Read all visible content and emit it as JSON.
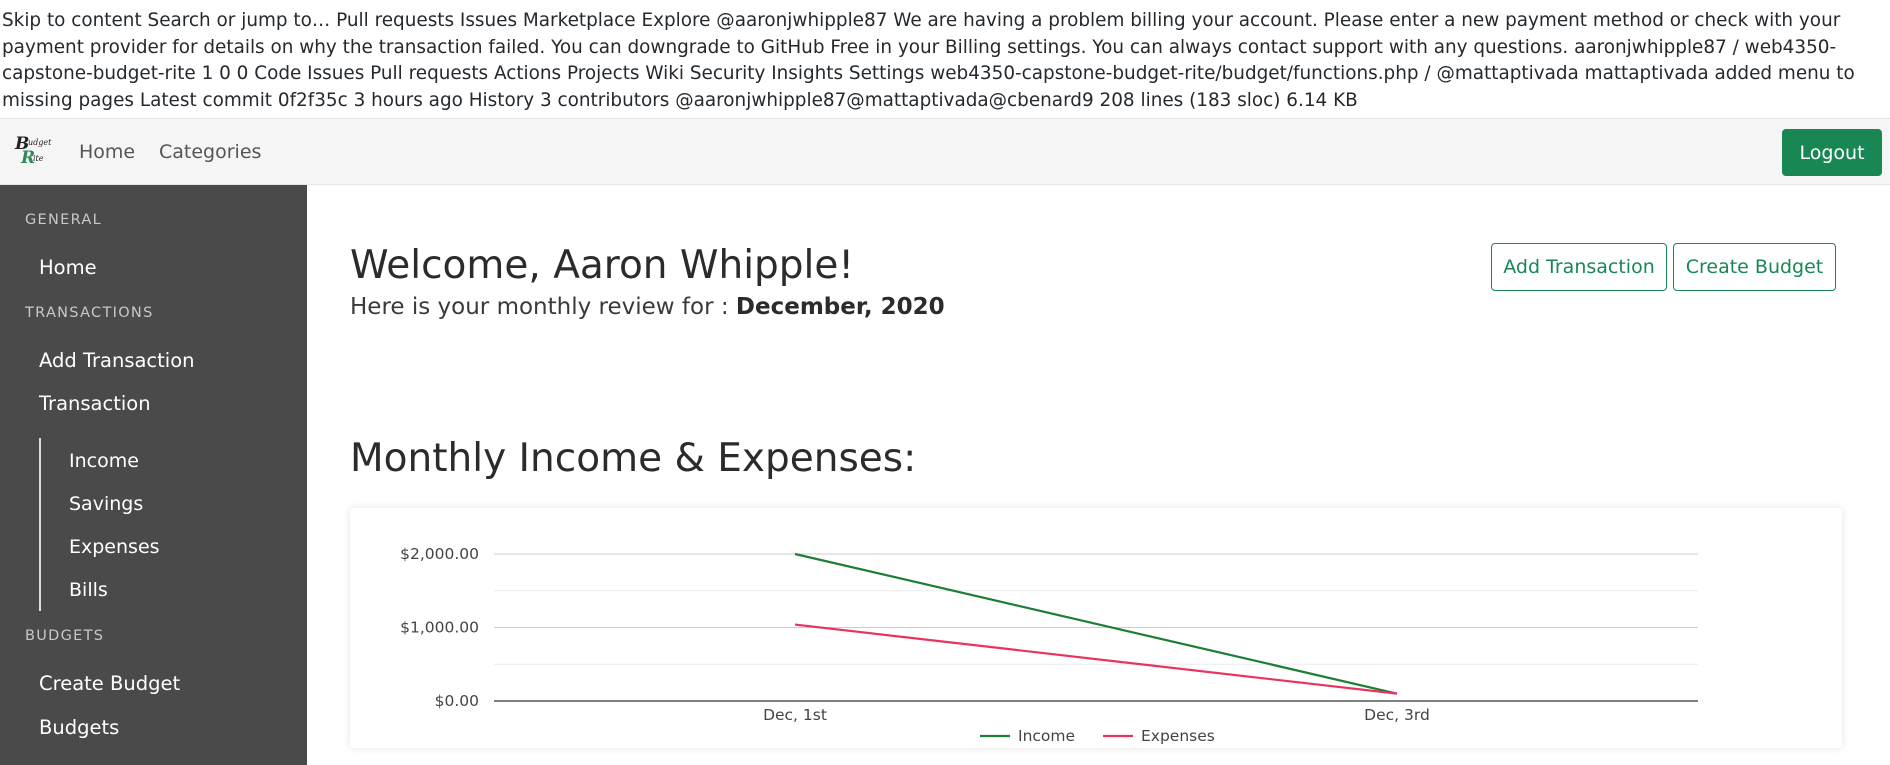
{
  "github_text": "Skip to content Search or jump to… Pull requests Issues Marketplace Explore @aaronjwhipple87 We are having a problem billing your account. Please enter a new payment method or check with your payment provider for details on why the transaction failed. You can downgrade to GitHub Free in your Billing settings. You can always contact support with any questions. aaronjwhipple87 / web4350-capstone-budget-rite 1 0 0 Code Issues Pull requests Actions Projects Wiki Security Insights Settings web4350-capstone-budget-rite/budget/functions.php / @mattaptivada mattaptivada added menu to missing pages Latest commit 0f2f35c 3 hours ago History 3 contributors @aaronjwhipple87@mattaptivada@cbenard9 208 lines (183 sloc) 6.14 KB",
  "navbar": {
    "logo": "Budget Rite",
    "links": [
      "Home",
      "Categories"
    ],
    "logout_label": "Logout"
  },
  "sidebar": {
    "general_heading": "GENERAL",
    "home": "Home",
    "transactions_heading": "TRANSACTIONS",
    "add_transaction": "Add Transaction",
    "transaction": "Transaction",
    "sub_items": [
      "Income",
      "Savings",
      "Expenses",
      "Bills"
    ],
    "budgets_heading": "BUDGETS",
    "create_budget": "Create Budget",
    "budgets": "Budgets"
  },
  "main": {
    "welcome": "Welcome, Aaron Whipple!",
    "review_prefix": "Here is your monthly review for : ",
    "review_month": "December, 2020",
    "add_transaction_button": "Add Transaction",
    "create_budget_button": "Create Budget",
    "section_title": "Monthly Income & Expenses:"
  },
  "chart_data": {
    "type": "line",
    "categories": [
      "Dec, 1st",
      "Dec, 3rd"
    ],
    "series": [
      {
        "name": "Income",
        "values": [
          2000,
          100
        ],
        "color": "#1e7e34"
      },
      {
        "name": "Expenses",
        "values": [
          1040,
          100
        ],
        "color": "#e8335e"
      }
    ],
    "y_ticks": [
      0,
      1000,
      2000
    ],
    "y_tick_labels": [
      "$0.00",
      "$1,000.00",
      "$2,000.00"
    ],
    "ylim": [
      0,
      2000
    ],
    "grid": true,
    "legend": "bottom"
  }
}
